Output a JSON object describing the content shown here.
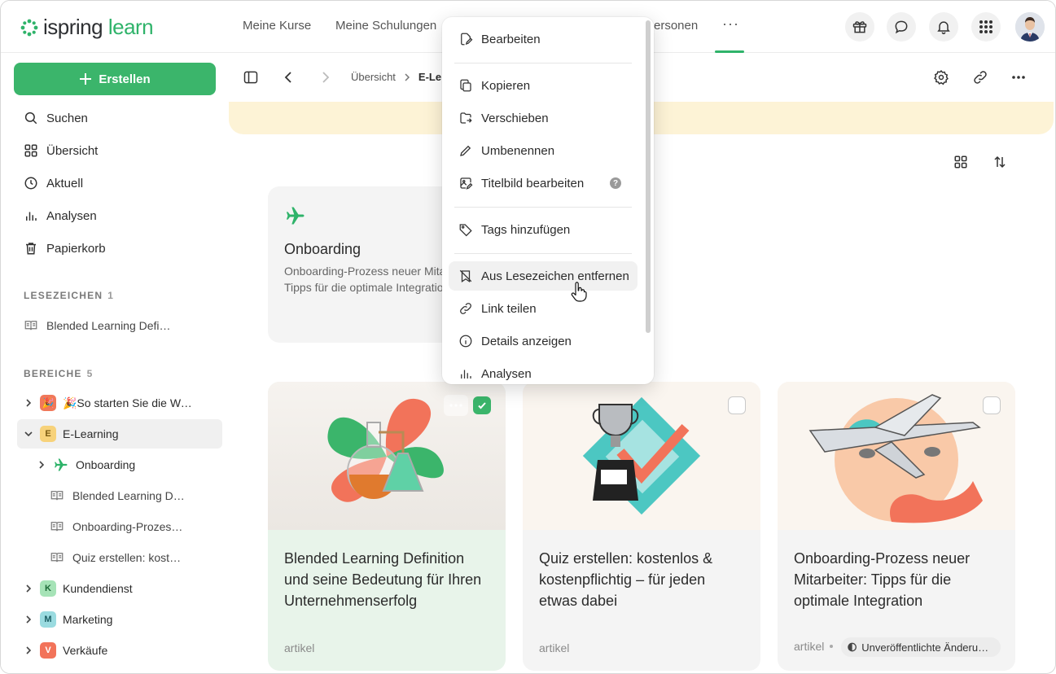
{
  "app": {
    "logo_main": "ispring",
    "logo_accent": "learn"
  },
  "topnav": {
    "items": [
      "Meine Kurse",
      "Meine Schulungen",
      "ersonen"
    ],
    "more": "···"
  },
  "sidebar": {
    "create_label": "Erstellen",
    "items": [
      "Suchen",
      "Übersicht",
      "Aktuell",
      "Analysen",
      "Papierkorb"
    ],
    "bookmarks_title": "LESEZEICHEN",
    "bookmarks_count": "1",
    "bookmarks": [
      "Blended Learning Definition und seine Bedeutung"
    ],
    "areas_title": "BEREICHE",
    "areas_count": "5",
    "tree": [
      {
        "badge": "🎉",
        "label": "🎉So starten Sie die Weiterbildung",
        "color": "#f0785a"
      },
      {
        "badge": "E",
        "label": "E-Learning",
        "color": "#f7d27a"
      },
      {
        "label": "Onboarding"
      },
      {
        "label": "Blended Learning Definition"
      },
      {
        "label": "Onboarding-Prozess neuer Mitarbeiter"
      },
      {
        "label": "Quiz erstellen: kostenlos"
      },
      {
        "badge": "K",
        "label": "Kundendienst",
        "color": "#a6e3b7"
      },
      {
        "badge": "M",
        "label": "Marketing",
        "color": "#9adbe0"
      },
      {
        "badge": "V",
        "label": "Verkäufe",
        "color": "#f2735a"
      }
    ]
  },
  "breadcrumb": {
    "root": "Übersicht",
    "current": "E-Le"
  },
  "folder_card": {
    "title": "Onboarding",
    "desc_line1": "Onboarding-Prozess neuer Mitar",
    "desc_line2": "Tipps für die optimale Integratio"
  },
  "cards": [
    {
      "title": "Blended Learning Definition und seine Bedeutung für Ihren Unternehmenserfolg",
      "type": "artikel",
      "checked": true
    },
    {
      "title": "Quiz erstellen: kostenlos & kostenpflichtig – für jeden etwas dabei",
      "type": "artikel",
      "checked": false
    },
    {
      "title": "Onboarding-Prozess neuer Mitarbeiter: Tipps für die optimale Integration",
      "type": "artikel",
      "checked": false,
      "status": "Unveröffentlichte Änderungen"
    }
  ],
  "menu": {
    "items": [
      "Bearbeiten",
      "Kopieren",
      "Verschieben",
      "Umbenennen",
      "Titelbild bearbeiten",
      "Tags hinzufügen",
      "Aus Lesezeichen entfernen",
      "Link teilen",
      "Details anzeigen",
      "Analysen"
    ],
    "help": "?"
  },
  "colors": {
    "accent": "#3bb56b",
    "banner": "#fdf3d6"
  }
}
